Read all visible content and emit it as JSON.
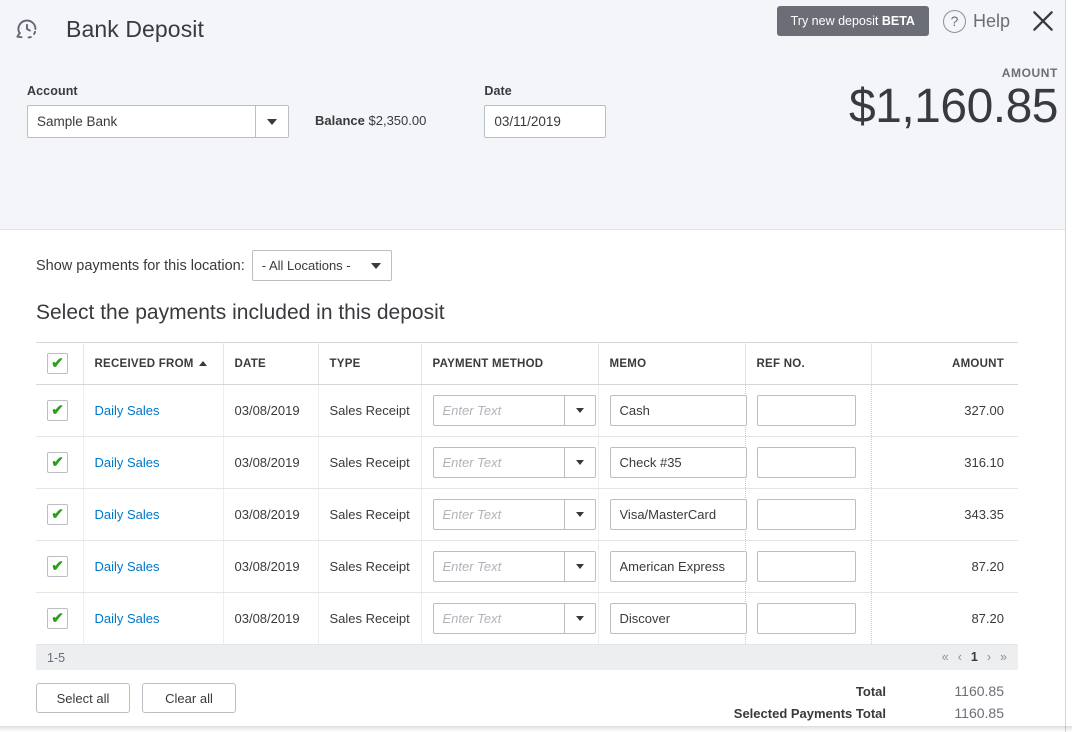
{
  "header": {
    "history_icon": "history-clock-icon",
    "title": "Bank Deposit",
    "beta_button_text": "Try new deposit ",
    "beta_button_tag": "BETA",
    "help_icon": "question-mark-icon",
    "help_label": "Help",
    "close_icon": "close-x-icon"
  },
  "form": {
    "account_label": "Account",
    "account_value": "Sample Bank",
    "balance_label": "Balance",
    "balance_value": "$2,350.00",
    "date_label": "Date",
    "date_value": "03/11/2019",
    "amount_label": "AMOUNT",
    "amount_value": "$1,160.85"
  },
  "filter": {
    "location_label": "Show payments for this location:",
    "location_value": "- All Locations -"
  },
  "section": {
    "heading": "Select the payments included in this deposit"
  },
  "table": {
    "header_checkbox": "✔",
    "columns": [
      "RECEIVED FROM",
      "DATE",
      "TYPE",
      "PAYMENT METHOD",
      "MEMO",
      "REF NO.",
      "AMOUNT"
    ],
    "sort_column": "RECEIVED FROM",
    "sort_direction": "asc",
    "payment_method_placeholder": "Enter Text",
    "rows": [
      {
        "checked": "✔",
        "received_from": "Daily Sales",
        "date": "03/08/2019",
        "type": "Sales Receipt",
        "payment_method": "",
        "memo": "Cash",
        "ref_no": "",
        "amount": "327.00"
      },
      {
        "checked": "✔",
        "received_from": "Daily Sales",
        "date": "03/08/2019",
        "type": "Sales Receipt",
        "payment_method": "",
        "memo": "Check #35",
        "ref_no": "",
        "amount": "316.10"
      },
      {
        "checked": "✔",
        "received_from": "Daily Sales",
        "date": "03/08/2019",
        "type": "Sales Receipt",
        "payment_method": "",
        "memo": "Visa/MasterCard",
        "ref_no": "",
        "amount": "343.35"
      },
      {
        "checked": "✔",
        "received_from": "Daily Sales",
        "date": "03/08/2019",
        "type": "Sales Receipt",
        "payment_method": "",
        "memo": "American Express",
        "ref_no": "",
        "amount": "87.20"
      },
      {
        "checked": "✔",
        "received_from": "Daily Sales",
        "date": "03/08/2019",
        "type": "Sales Receipt",
        "payment_method": "",
        "memo": "Discover",
        "ref_no": "",
        "amount": "87.20"
      }
    ]
  },
  "footer": {
    "range_label": "1-5",
    "pager": {
      "first": "«",
      "prev": "‹",
      "current": "1",
      "next": "›",
      "last": "»"
    },
    "select_all_label": "Select all",
    "clear_all_label": "Clear all",
    "total_label": "Total",
    "total_value": "1160.85",
    "selected_total_label": "Selected Payments Total",
    "selected_total_value": "1160.85"
  },
  "colors": {
    "accent_link": "#0077c5",
    "check_green": "#2ca01c",
    "header_bg": "#f4f5f8",
    "beta_button_bg": "#6b6e76",
    "text_primary": "#393a3d"
  }
}
